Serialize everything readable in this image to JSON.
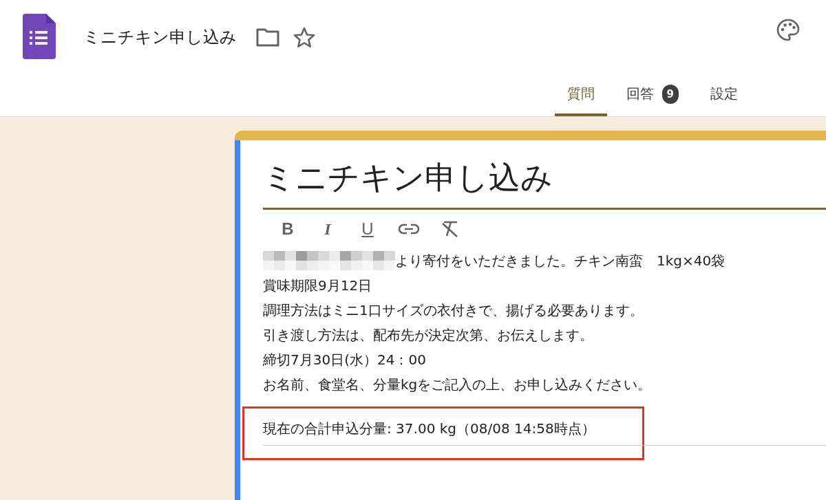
{
  "header": {
    "title": "ミニチキン申し込み"
  },
  "tabs": [
    {
      "label": "質問",
      "selected": true
    },
    {
      "label": "回答",
      "selected": false,
      "badge": "9"
    },
    {
      "label": "設定",
      "selected": false
    }
  ],
  "form": {
    "title": "ミニチキン申し込み",
    "toolbar": [
      "B",
      "I",
      "U"
    ],
    "description_lines": [
      {
        "text": "より寄付をいただきました。チキン南蛮　1kg×40袋",
        "redacted": true
      },
      {
        "text": "賞味期限9月12日",
        "redacted": false
      },
      {
        "text": "調理方法はミニ1口サイズの衣付きで、揚げる必要あります。",
        "redacted": false
      },
      {
        "text": "引き渡し方法は、配布先が決定次第、お伝えします。",
        "redacted": false
      },
      {
        "text": "締切7月30日(水）24：00",
        "redacted": false
      },
      {
        "text": "お名前、食堂名、分量kgをご記入の上、お申し込みください。",
        "redacted": false
      }
    ],
    "total": {
      "text": "現在の合計申込分量: 37.00 kg（08/08 14:58時点）",
      "highlighted": true
    }
  }
}
